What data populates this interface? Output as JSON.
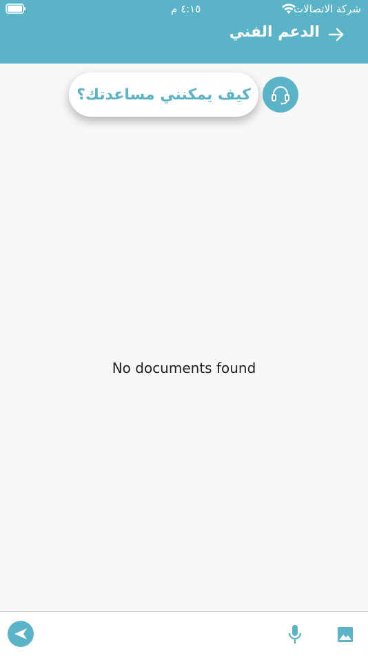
{
  "status_bar": {
    "carrier": "شركة الاتصالات",
    "time": "٤:١٥ م"
  },
  "header": {
    "title": "الدعم الفني"
  },
  "greeting": {
    "text": "كيف يمكنني مساعدتك؟"
  },
  "empty_state": {
    "message": "No documents found"
  },
  "colors": {
    "accent": "#5bb3c7",
    "background": "#f8f8f8",
    "text": "#222222"
  },
  "icons": {
    "back": "arrow-right-icon",
    "agent": "headset-icon",
    "send": "send-icon",
    "mic": "microphone-icon",
    "image": "image-icon",
    "wifi": "wifi-icon",
    "battery": "battery-icon"
  }
}
